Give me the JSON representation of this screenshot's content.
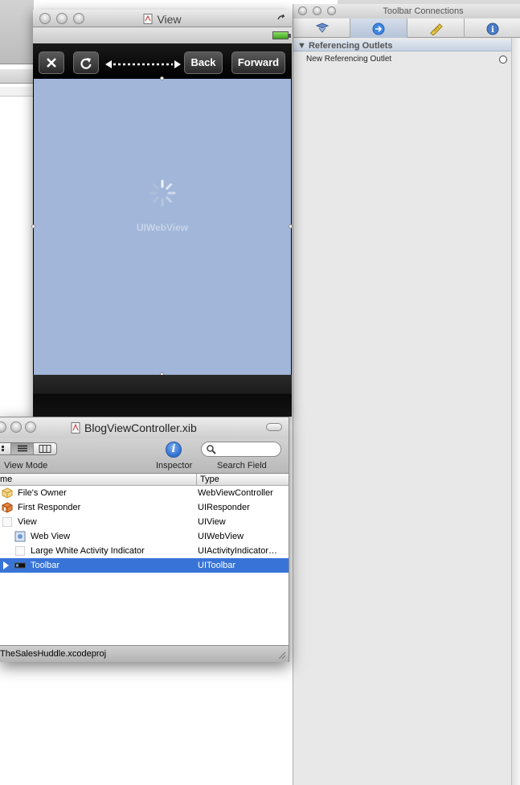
{
  "view_window": {
    "title": "View",
    "toolbar": {
      "back_label": "Back",
      "forward_label": "Forward"
    },
    "webview_label": "UIWebView"
  },
  "inspector": {
    "title": "Toolbar Connections",
    "tabs": [
      "attributes-icon",
      "connections-icon",
      "size-icon",
      "identity-icon"
    ],
    "active_tab": 1,
    "section_title": "Referencing Outlets",
    "outlet_label": "New Referencing Outlet"
  },
  "xib_window": {
    "title": "BlogViewController.xib",
    "view_mode_label": "View Mode",
    "inspector_label": "Inspector",
    "search_label": "Search Field",
    "columns": {
      "name": "me",
      "type": "Type"
    },
    "rows": [
      {
        "name": "File's Owner",
        "type": "WebViewController",
        "icon": "cube-icon"
      },
      {
        "name": "First Responder",
        "type": "UIResponder",
        "icon": "responder-cube-icon"
      },
      {
        "name": "View",
        "type": "UIView",
        "icon": "view-icon"
      },
      {
        "name": "Web View",
        "type": "UIWebView",
        "icon": "webview-icon"
      },
      {
        "name": "Large White Activity Indicator",
        "type": "UIActivityIndicator…",
        "icon": "activity-indicator-icon"
      },
      {
        "name": "Toolbar",
        "type": "UIToolbar",
        "icon": "toolbar-icon",
        "selected": true
      }
    ],
    "status_text": "TheSalesHuddle.xcodeproj"
  },
  "colors": {
    "selection": "#3874d7",
    "webview_bg": "#a1b6d9",
    "toolbar_bg": "#000000"
  }
}
